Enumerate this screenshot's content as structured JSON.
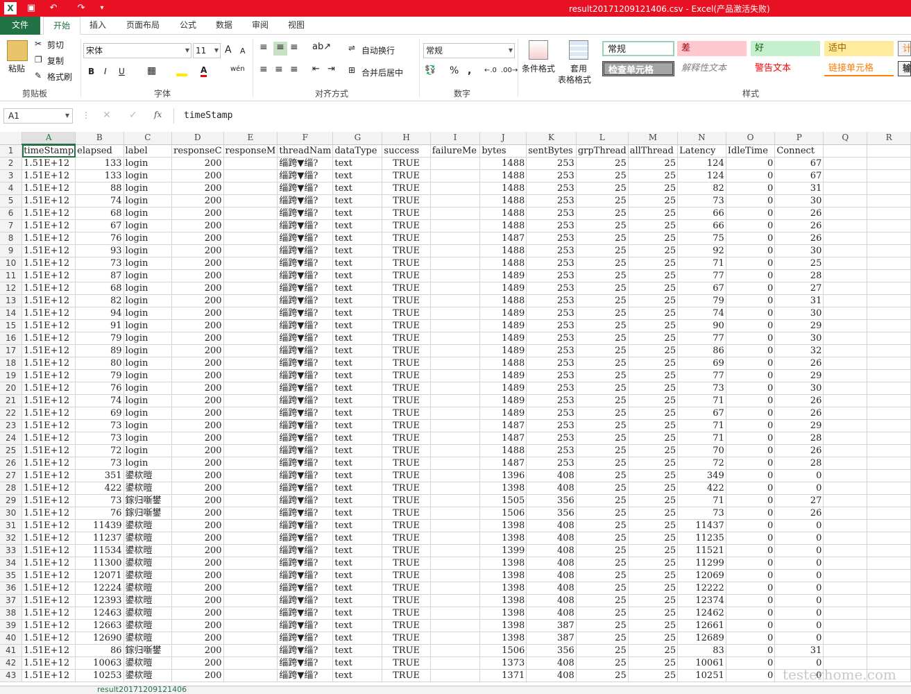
{
  "title": "result20171209121406.csv  -  Excel(产品激活失败)",
  "tabs": [
    "文件",
    "开始",
    "插入",
    "页面布局",
    "公式",
    "数据",
    "审阅",
    "视图"
  ],
  "ribbon": {
    "clipboard": {
      "paste": "粘贴",
      "cut": "剪切",
      "copy": "复制",
      "painter": "格式刷",
      "label": "剪贴板"
    },
    "font": {
      "name": "宋体",
      "size": "11",
      "label": "字体",
      "wen": "wén",
      "bold": "B",
      "italic": "I",
      "underline": "U",
      "grow": "A",
      "shrink": "A"
    },
    "align": {
      "wrap": "自动换行",
      "merge": "合并后居中",
      "label": "对齐方式"
    },
    "number": {
      "format": "常规",
      "label": "数字",
      "pct": "%",
      "comma": ","
    },
    "styles": {
      "cond": "条件格式",
      "table1": "套用",
      "table2": "表格格式",
      "normal": "常规",
      "bad": "差",
      "good": "好",
      "neutral": "适中",
      "calc": "计",
      "check": "检查单元格",
      "explain": "解释性文本",
      "warn": "警告文本",
      "link": "链接单元格",
      "out": "输",
      "label": "样式"
    }
  },
  "formula": {
    "namebox": "A1",
    "fx": "fx",
    "value": "timeStamp"
  },
  "columns": [
    "A",
    "B",
    "C",
    "D",
    "E",
    "F",
    "G",
    "H",
    "I",
    "J",
    "K",
    "L",
    "M",
    "N",
    "O",
    "P",
    "Q",
    "R"
  ],
  "headers": [
    "timeStamp",
    "elapsed",
    "label",
    "responseCode",
    "responseMessage",
    "threadName",
    "dataType",
    "success",
    "failureMessage",
    "bytes",
    "sentBytes",
    "grpThreads",
    "allThreads",
    "Latency",
    "IdleTime",
    "Connect"
  ],
  "header_display": [
    "timeStamp",
    "elapsed",
    "label",
    "responseC",
    "responseM",
    "threadNam",
    "dataType",
    "success",
    "failureMe",
    "bytes",
    "sentBytes",
    "grpThread",
    "allThread",
    "Latency",
    "IdleTime",
    "Connect"
  ],
  "rows": [
    [
      "1.51E+12",
      "133",
      "login",
      "200",
      "",
      "缁跨▼缁?",
      "text",
      "TRUE",
      "",
      "1488",
      "253",
      "25",
      "25",
      "124",
      "0",
      "67"
    ],
    [
      "1.51E+12",
      "133",
      "login",
      "200",
      "",
      "缁跨▼缁?",
      "text",
      "TRUE",
      "",
      "1488",
      "253",
      "25",
      "25",
      "124",
      "0",
      "67"
    ],
    [
      "1.51E+12",
      "88",
      "login",
      "200",
      "",
      "缁跨▼缁?",
      "text",
      "TRUE",
      "",
      "1488",
      "253",
      "25",
      "25",
      "82",
      "0",
      "31"
    ],
    [
      "1.51E+12",
      "74",
      "login",
      "200",
      "",
      "缁跨▼缁?",
      "text",
      "TRUE",
      "",
      "1488",
      "253",
      "25",
      "25",
      "73",
      "0",
      "30"
    ],
    [
      "1.51E+12",
      "68",
      "login",
      "200",
      "",
      "缁跨▼缁?",
      "text",
      "TRUE",
      "",
      "1488",
      "253",
      "25",
      "25",
      "66",
      "0",
      "26"
    ],
    [
      "1.51E+12",
      "67",
      "login",
      "200",
      "",
      "缁跨▼缁?",
      "text",
      "TRUE",
      "",
      "1488",
      "253",
      "25",
      "25",
      "66",
      "0",
      "26"
    ],
    [
      "1.51E+12",
      "76",
      "login",
      "200",
      "",
      "缁跨▼缁?",
      "text",
      "TRUE",
      "",
      "1487",
      "253",
      "25",
      "25",
      "75",
      "0",
      "26"
    ],
    [
      "1.51E+12",
      "93",
      "login",
      "200",
      "",
      "缁跨▼缁?",
      "text",
      "TRUE",
      "",
      "1488",
      "253",
      "25",
      "25",
      "92",
      "0",
      "30"
    ],
    [
      "1.51E+12",
      "73",
      "login",
      "200",
      "",
      "缁跨▼缁?",
      "text",
      "TRUE",
      "",
      "1488",
      "253",
      "25",
      "25",
      "71",
      "0",
      "25"
    ],
    [
      "1.51E+12",
      "87",
      "login",
      "200",
      "",
      "缁跨▼缁?",
      "text",
      "TRUE",
      "",
      "1489",
      "253",
      "25",
      "25",
      "77",
      "0",
      "28"
    ],
    [
      "1.51E+12",
      "68",
      "login",
      "200",
      "",
      "缁跨▼缁?",
      "text",
      "TRUE",
      "",
      "1489",
      "253",
      "25",
      "25",
      "67",
      "0",
      "27"
    ],
    [
      "1.51E+12",
      "82",
      "login",
      "200",
      "",
      "缁跨▼缁?",
      "text",
      "TRUE",
      "",
      "1488",
      "253",
      "25",
      "25",
      "79",
      "0",
      "31"
    ],
    [
      "1.51E+12",
      "94",
      "login",
      "200",
      "",
      "缁跨▼缁?",
      "text",
      "TRUE",
      "",
      "1489",
      "253",
      "25",
      "25",
      "74",
      "0",
      "30"
    ],
    [
      "1.51E+12",
      "91",
      "login",
      "200",
      "",
      "缁跨▼缁?",
      "text",
      "TRUE",
      "",
      "1489",
      "253",
      "25",
      "25",
      "90",
      "0",
      "29"
    ],
    [
      "1.51E+12",
      "79",
      "login",
      "200",
      "",
      "缁跨▼缁?",
      "text",
      "TRUE",
      "",
      "1489",
      "253",
      "25",
      "25",
      "77",
      "0",
      "30"
    ],
    [
      "1.51E+12",
      "89",
      "login",
      "200",
      "",
      "缁跨▼缁?",
      "text",
      "TRUE",
      "",
      "1489",
      "253",
      "25",
      "25",
      "86",
      "0",
      "32"
    ],
    [
      "1.51E+12",
      "80",
      "login",
      "200",
      "",
      "缁跨▼缁?",
      "text",
      "TRUE",
      "",
      "1488",
      "253",
      "25",
      "25",
      "69",
      "0",
      "26"
    ],
    [
      "1.51E+12",
      "79",
      "login",
      "200",
      "",
      "缁跨▼缁?",
      "text",
      "TRUE",
      "",
      "1489",
      "253",
      "25",
      "25",
      "77",
      "0",
      "29"
    ],
    [
      "1.51E+12",
      "76",
      "login",
      "200",
      "",
      "缁跨▼缁?",
      "text",
      "TRUE",
      "",
      "1489",
      "253",
      "25",
      "25",
      "73",
      "0",
      "30"
    ],
    [
      "1.51E+12",
      "74",
      "login",
      "200",
      "",
      "缁跨▼缁?",
      "text",
      "TRUE",
      "",
      "1489",
      "253",
      "25",
      "25",
      "71",
      "0",
      "26"
    ],
    [
      "1.51E+12",
      "69",
      "login",
      "200",
      "",
      "缁跨▼缁?",
      "text",
      "TRUE",
      "",
      "1489",
      "253",
      "25",
      "25",
      "67",
      "0",
      "26"
    ],
    [
      "1.51E+12",
      "73",
      "login",
      "200",
      "",
      "缁跨▼缁?",
      "text",
      "TRUE",
      "",
      "1487",
      "253",
      "25",
      "25",
      "71",
      "0",
      "29"
    ],
    [
      "1.51E+12",
      "73",
      "login",
      "200",
      "",
      "缁跨▼缁?",
      "text",
      "TRUE",
      "",
      "1487",
      "253",
      "25",
      "25",
      "71",
      "0",
      "28"
    ],
    [
      "1.51E+12",
      "72",
      "login",
      "200",
      "",
      "缁跨▼缁?",
      "text",
      "TRUE",
      "",
      "1488",
      "253",
      "25",
      "25",
      "70",
      "0",
      "26"
    ],
    [
      "1.51E+12",
      "73",
      "login",
      "200",
      "",
      "缁跨▼缁?",
      "text",
      "TRUE",
      "",
      "1487",
      "253",
      "25",
      "25",
      "72",
      "0",
      "28"
    ],
    [
      "1.51E+12",
      "351",
      "鍙栨暟",
      "200",
      "",
      "缁跨▼缁?",
      "text",
      "TRUE",
      "",
      "1396",
      "408",
      "25",
      "25",
      "349",
      "0",
      "0"
    ],
    [
      "1.51E+12",
      "422",
      "鍙栨暟",
      "200",
      "",
      "缁跨▼缁?",
      "text",
      "TRUE",
      "",
      "1398",
      "408",
      "25",
      "25",
      "422",
      "0",
      "0"
    ],
    [
      "1.51E+12",
      "73",
      "鎵归噺鐢",
      "200",
      "",
      "缁跨▼缁?",
      "text",
      "TRUE",
      "",
      "1505",
      "356",
      "25",
      "25",
      "71",
      "0",
      "27"
    ],
    [
      "1.51E+12",
      "76",
      "鎵归噺鐢",
      "200",
      "",
      "缁跨▼缁?",
      "text",
      "TRUE",
      "",
      "1506",
      "356",
      "25",
      "25",
      "73",
      "0",
      "26"
    ],
    [
      "1.51E+12",
      "11439",
      "鍙栨暟",
      "200",
      "",
      "缁跨▼缁?",
      "text",
      "TRUE",
      "",
      "1398",
      "408",
      "25",
      "25",
      "11437",
      "0",
      "0"
    ],
    [
      "1.51E+12",
      "11237",
      "鍙栨暟",
      "200",
      "",
      "缁跨▼缁?",
      "text",
      "TRUE",
      "",
      "1398",
      "408",
      "25",
      "25",
      "11235",
      "0",
      "0"
    ],
    [
      "1.51E+12",
      "11534",
      "鍙栨暟",
      "200",
      "",
      "缁跨▼缁?",
      "text",
      "TRUE",
      "",
      "1399",
      "408",
      "25",
      "25",
      "11521",
      "0",
      "0"
    ],
    [
      "1.51E+12",
      "11300",
      "鍙栨暟",
      "200",
      "",
      "缁跨▼缁?",
      "text",
      "TRUE",
      "",
      "1398",
      "408",
      "25",
      "25",
      "11299",
      "0",
      "0"
    ],
    [
      "1.51E+12",
      "12071",
      "鍙栨暟",
      "200",
      "",
      "缁跨▼缁?",
      "text",
      "TRUE",
      "",
      "1398",
      "408",
      "25",
      "25",
      "12069",
      "0",
      "0"
    ],
    [
      "1.51E+12",
      "12224",
      "鍙栨暟",
      "200",
      "",
      "缁跨▼缁?",
      "text",
      "TRUE",
      "",
      "1398",
      "408",
      "25",
      "25",
      "12222",
      "0",
      "0"
    ],
    [
      "1.51E+12",
      "12393",
      "鍙栨暟",
      "200",
      "",
      "缁跨▼缁?",
      "text",
      "TRUE",
      "",
      "1398",
      "408",
      "25",
      "25",
      "12374",
      "0",
      "0"
    ],
    [
      "1.51E+12",
      "12463",
      "鍙栨暟",
      "200",
      "",
      "缁跨▼缁?",
      "text",
      "TRUE",
      "",
      "1398",
      "408",
      "25",
      "25",
      "12462",
      "0",
      "0"
    ],
    [
      "1.51E+12",
      "12663",
      "鍙栨暟",
      "200",
      "",
      "缁跨▼缁?",
      "text",
      "TRUE",
      "",
      "1398",
      "387",
      "25",
      "25",
      "12661",
      "0",
      "0"
    ],
    [
      "1.51E+12",
      "12690",
      "鍙栨暟",
      "200",
      "",
      "缁跨▼缁?",
      "text",
      "TRUE",
      "",
      "1398",
      "387",
      "25",
      "25",
      "12689",
      "0",
      "0"
    ],
    [
      "1.51E+12",
      "86",
      "鎵归噺鐢",
      "200",
      "",
      "缁跨▼缁?",
      "text",
      "TRUE",
      "",
      "1506",
      "356",
      "25",
      "25",
      "83",
      "0",
      "31"
    ],
    [
      "1.51E+12",
      "10063",
      "鍙栨暟",
      "200",
      "",
      "缁跨▼缁?",
      "text",
      "TRUE",
      "",
      "1373",
      "408",
      "25",
      "25",
      "10061",
      "0",
      "0"
    ],
    [
      "1.51E+12",
      "10253",
      "鍙栨暟",
      "200",
      "",
      "缁跨▼缁?",
      "text",
      "TRUE",
      "",
      "1371",
      "408",
      "25",
      "25",
      "10251",
      "0",
      "0"
    ]
  ],
  "sheet_tab": "result20171209121406",
  "watermark": "testerhome.com"
}
